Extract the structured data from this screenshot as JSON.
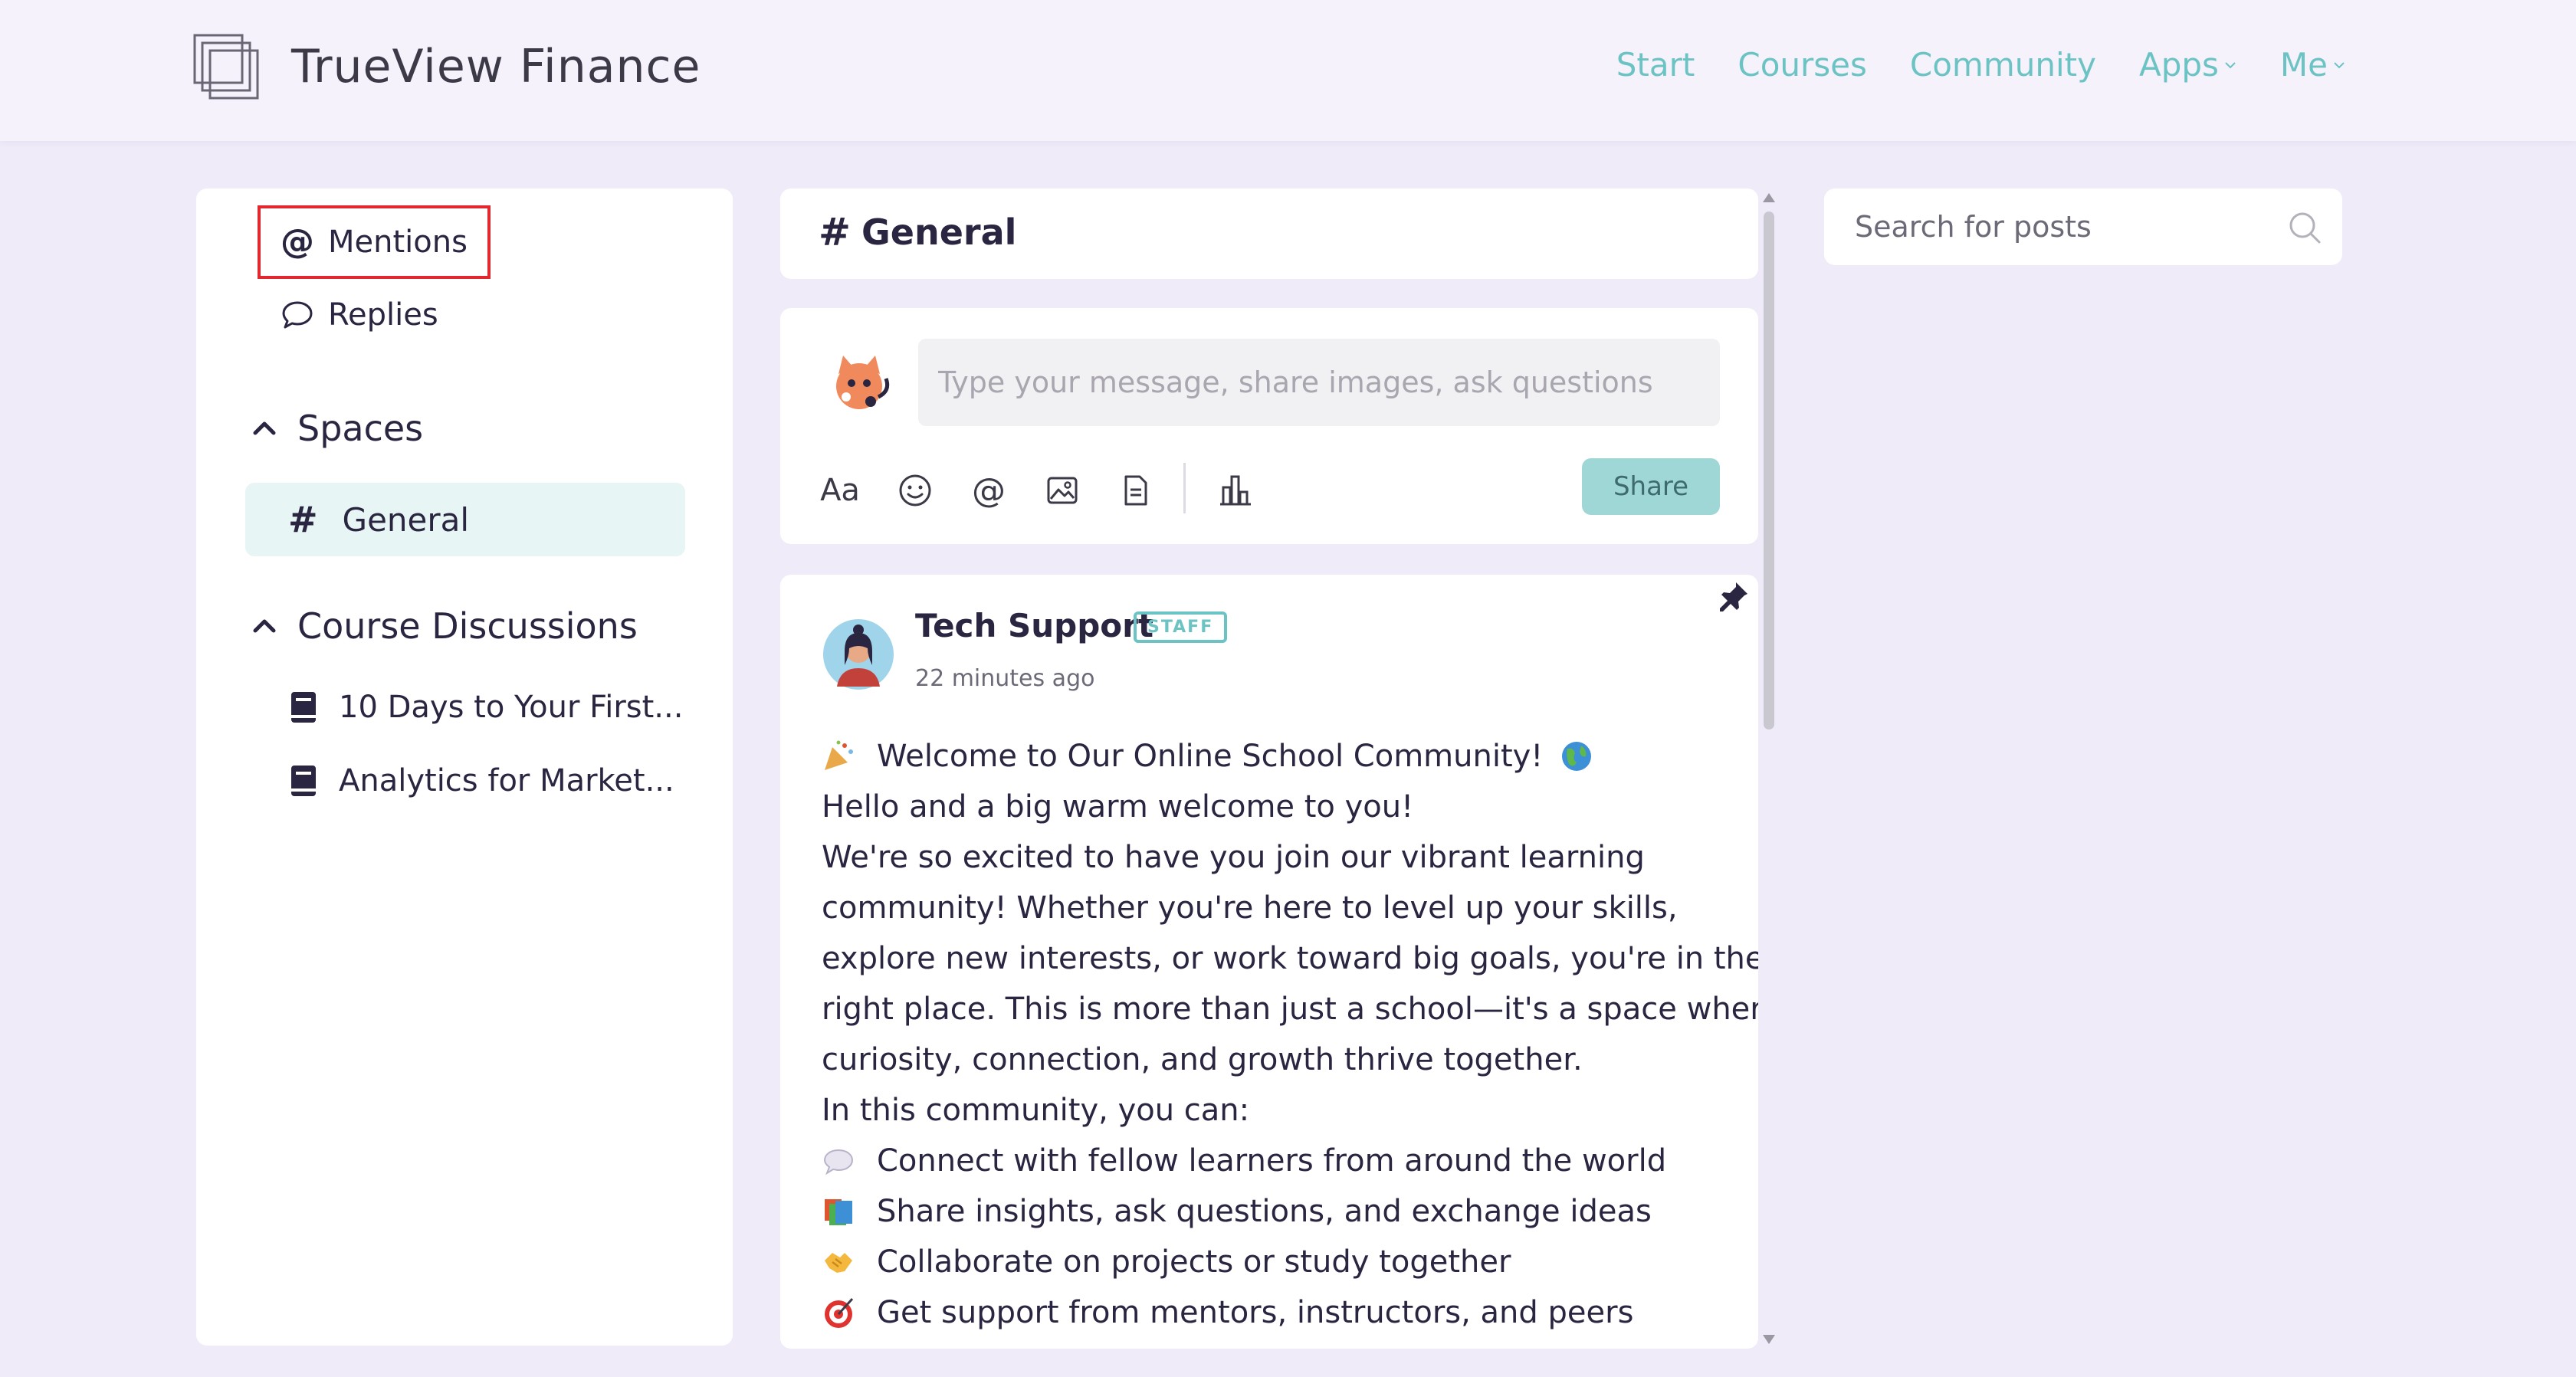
{
  "brand": {
    "name": "TrueView Finance"
  },
  "nav": {
    "items": [
      {
        "label": "Start",
        "dropdown": false
      },
      {
        "label": "Courses",
        "dropdown": false
      },
      {
        "label": "Community",
        "dropdown": false
      },
      {
        "label": "Apps",
        "dropdown": true
      },
      {
        "label": "Me",
        "dropdown": true
      }
    ]
  },
  "sidebar": {
    "mentions_label": "Mentions",
    "replies_label": "Replies",
    "spaces_heading": "Spaces",
    "spaces": [
      {
        "label": "General",
        "active": true
      }
    ],
    "courses_heading": "Course Discussions",
    "courses": [
      {
        "label": "10 Days to Your First..."
      },
      {
        "label": "Analytics for Market..."
      }
    ]
  },
  "channel": {
    "title": "General"
  },
  "composer": {
    "placeholder": "Type your message, share images, ask questions",
    "format_label": "Aa",
    "share_label": "Share"
  },
  "post": {
    "author": "Tech Support",
    "badge": "STAFF",
    "time": "22 minutes ago",
    "lines": [
      "Welcome to Our Online School Community!",
      "Hello and a big warm welcome to you!",
      "We're so excited to have you join our vibrant learning",
      "community! Whether you're here to level up your skills,",
      "explore new interests, or work toward big goals, you're in the",
      "right place. This is more than just a school—it's a space where",
      "curiosity, connection, and growth thrive together.",
      "In this community, you can:",
      "Connect with fellow learners from around the world",
      "Share insights, ask questions, and exchange ideas",
      "Collaborate on projects or study together",
      "Get support from mentors, instructors, and peers"
    ]
  },
  "search": {
    "placeholder": "Search for posts"
  },
  "colors": {
    "accent": "#6cc3c4",
    "highlight": "#e0282e",
    "active_bg": "#e7f5f4"
  }
}
